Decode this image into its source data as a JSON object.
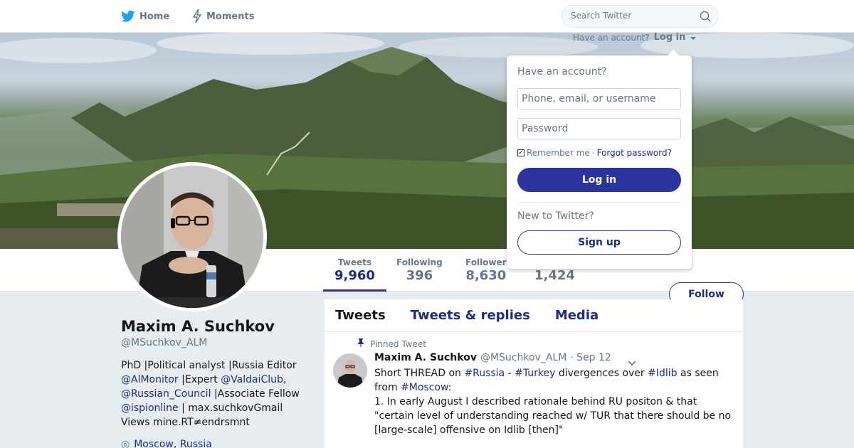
{
  "nav": {
    "home_label": "Home",
    "moments_label": "Moments",
    "search_placeholder": "Search Twitter",
    "icons": {
      "home": "twitter-bird-icon",
      "moments": "lightning-icon",
      "search": "search-icon"
    }
  },
  "account_hint": {
    "text": "Have an account?",
    "login_label": "Log in"
  },
  "login_box": {
    "title": "Have an account?",
    "username_placeholder": "Phone, email, or username",
    "password_placeholder": "Password",
    "remember_label": "Remember me",
    "separator": "·",
    "forgot_label": "Forgot password?",
    "login_button": "Log in",
    "new_label": "New to Twitter?",
    "signup_button": "Sign up"
  },
  "stats": [
    {
      "label": "Tweets",
      "value": "9,960",
      "active": true
    },
    {
      "label": "Following",
      "value": "396",
      "active": false
    },
    {
      "label": "Follower",
      "value": "8,630",
      "active": false
    },
    {
      "label": "",
      "value": "1,424",
      "active": false
    }
  ],
  "follow_button": "Follow",
  "profile": {
    "name": "Maxim A. Suchkov",
    "handle": "@MSuchkov_ALM",
    "bio": {
      "t1": "PhD |Political analyst |Russia Editor ",
      "l1": "@AlMonitor",
      "t2": " |Expert ",
      "l2": "@ValdaiClub",
      "t3": ", ",
      "l3": "@Russian_Council",
      "t4": " |Associate Fellow ",
      "l4": "@ispionline",
      "t5": " | max.suchkovGmail Views mine.RT≠endrsmnt"
    },
    "location": "Moscow, Russia",
    "location_icon": "◎"
  },
  "tabs": {
    "tweets": "Tweets",
    "replies": "Tweets & replies",
    "media": "Media"
  },
  "tweet": {
    "pinned_label": "Pinned Tweet",
    "name": "Maxim A. Suchkov",
    "handle": "@MSuchkov_ALM",
    "date": "· Sep 12",
    "text": {
      "a": "Short THREAD on ",
      "h1": "#Russia",
      "b": " - ",
      "h2": "#Turkey",
      "c": " divergences over ",
      "h3": "#Idlib",
      "d": " as seen from ",
      "h4": "#Moscow",
      "e": ":",
      "p2": "1. In early August I described rationale behind RU positon & that \"certain level of understanding reached w/ TUR that there should be no [large-scale] offensive on Idlib [then]\""
    }
  },
  "colors": {
    "accent": "#2b339c",
    "link": "#1b2e7e",
    "muted": "#657786",
    "background": "#e6ecf0"
  }
}
